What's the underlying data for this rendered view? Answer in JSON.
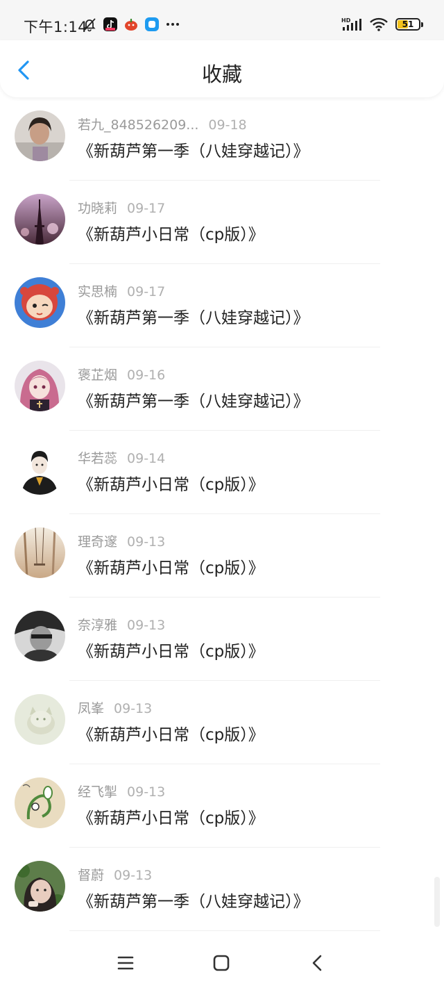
{
  "status_bar": {
    "time": "下午1:14",
    "battery_level": "51",
    "battery_fraction": 0.51,
    "left_icons": [
      "mute-bell-icon",
      "tiktok-app-icon",
      "pumpkin-app-icon",
      "blue-square-app-icon",
      "more-dots-icon"
    ],
    "right_icons": [
      "hd-signal-icon",
      "wifi-icon",
      "battery-icon"
    ]
  },
  "header": {
    "title": "收藏",
    "back_icon": "chevron-left-icon"
  },
  "colors": {
    "accent": "#2196f3",
    "meta_text": "#9a9a9a",
    "battery_fill": "#f3c21b"
  },
  "favorites": [
    {
      "name": "若九_848526209...",
      "date": "09-18",
      "title": "《新葫芦第一季（八娃穿越记）》",
      "avatar": "girl-photo"
    },
    {
      "name": "功晓莉",
      "date": "09-17",
      "title": "《新葫芦小日常（cp版）》",
      "avatar": "eiffel-tower-pink"
    },
    {
      "name": "实思楠",
      "date": "09-17",
      "title": "《新葫芦第一季（八娃穿越记）》",
      "avatar": "cartoon-girl-wink"
    },
    {
      "name": "褒芷烟",
      "date": "09-16",
      "title": "《新葫芦第一季（八娃穿越记）》",
      "avatar": "anime-girl-pink-hair"
    },
    {
      "name": "华若蕊",
      "date": "09-14",
      "title": "《新葫芦小日常（cp版）》",
      "avatar": "boy-black-hoodie"
    },
    {
      "name": "理奇邃",
      "date": "09-13",
      "title": "《新葫芦小日常（cp版）》",
      "avatar": "forest-swing"
    },
    {
      "name": "奈淳雅",
      "date": "09-13",
      "title": "《新葫芦小日常（cp版）》",
      "avatar": "bw-portrait"
    },
    {
      "name": "凤峯",
      "date": "09-13",
      "title": "《新葫芦小日常（cp版）》",
      "avatar": "pale-cat"
    },
    {
      "name": "经飞掣",
      "date": "09-13",
      "title": "《新葫芦小日常（cp版）》",
      "avatar": "green-doodle"
    },
    {
      "name": "督蔚",
      "date": "09-13",
      "title": "《新葫芦第一季（八娃穿越记）》",
      "avatar": "girl-green-leaves"
    }
  ],
  "bottom_nav": [
    "menu-icon",
    "home-square-icon",
    "back-chevron-icon"
  ]
}
